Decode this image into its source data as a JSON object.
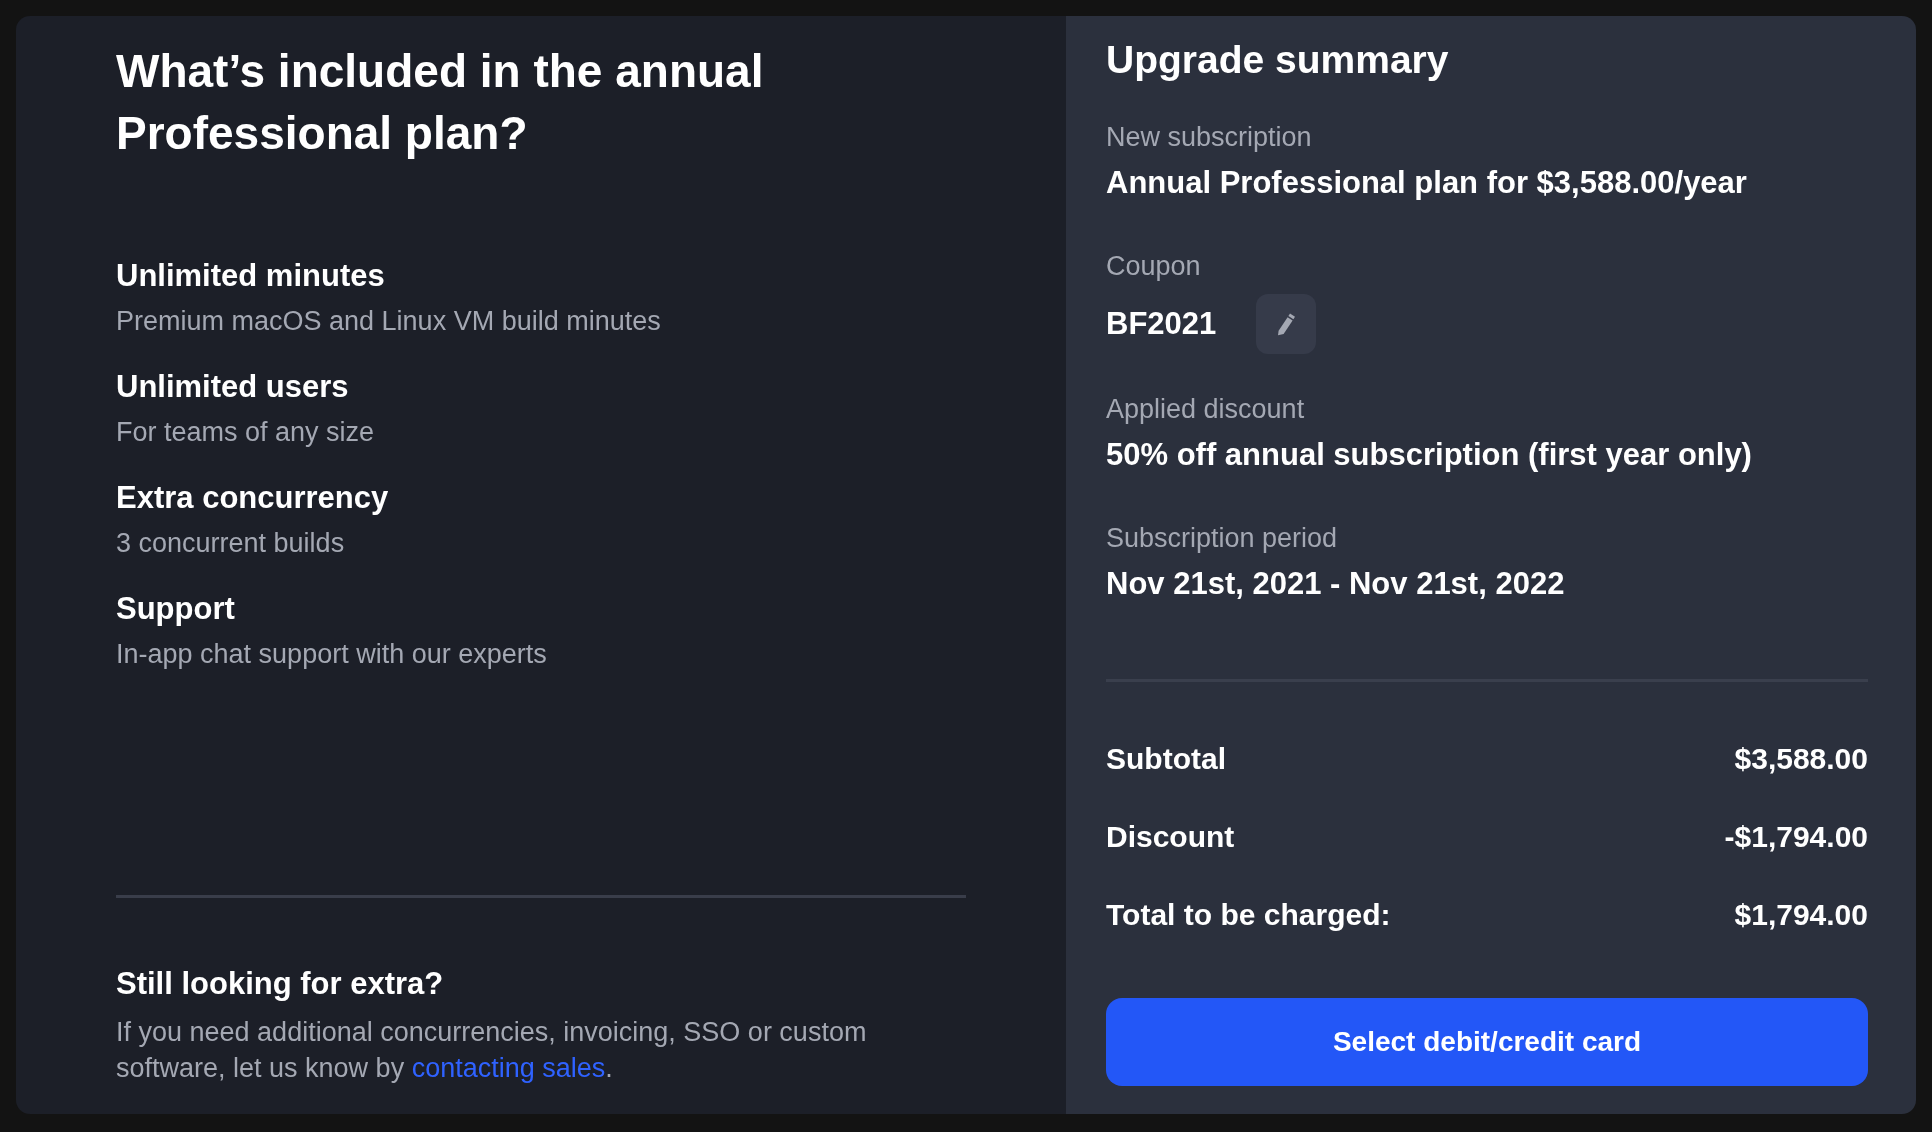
{
  "plan": {
    "title": "What’s included in the annual Professional plan?",
    "features": [
      {
        "title": "Unlimited minutes",
        "description": "Premium macOS and Linux VM build minutes"
      },
      {
        "title": "Unlimited users",
        "description": "For teams of any size"
      },
      {
        "title": "Extra concurrency",
        "description": "3 concurrent builds"
      },
      {
        "title": "Support",
        "description": "In-app chat support with our experts"
      }
    ],
    "extra": {
      "title": "Still looking for extra?",
      "text": "If you need additional concurrencies, invoicing, SSO or custom software, let us know by ",
      "link": "contacting sales",
      "after": "."
    }
  },
  "summary": {
    "title": "Upgrade summary",
    "fields": [
      {
        "kind": "text",
        "label": "New subscription",
        "value": "Annual Professional plan for $3,588.00/year"
      },
      {
        "kind": "coupon",
        "label": "Coupon",
        "value": "BF2021"
      },
      {
        "kind": "text",
        "label": "Applied discount",
        "value": "50% off annual subscription (first year only)"
      },
      {
        "kind": "text",
        "label": "Subscription period",
        "value": "Nov 21st, 2021 - Nov 21st, 2022"
      }
    ],
    "totals": [
      {
        "label": "Subtotal",
        "amount": "$3,588.00"
      },
      {
        "label": "Discount",
        "amount": "-$1,794.00"
      },
      {
        "label": "Total to be charged:",
        "amount": "$1,794.00"
      }
    ],
    "button": "Select debit/credit card"
  }
}
